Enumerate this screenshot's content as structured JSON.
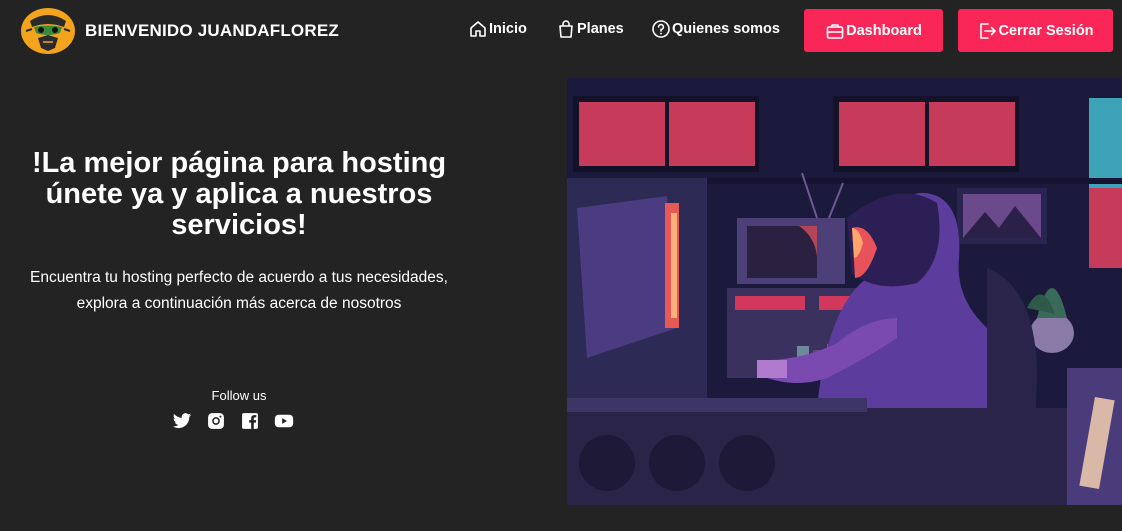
{
  "header": {
    "brand_title": "BIENVENIDO JUANDAFLOREZ",
    "nav": {
      "inicio": "Inicio",
      "planes": "Planes",
      "quienes": "Quienes somos"
    },
    "buttons": {
      "dashboard": "Dashboard",
      "logout": "Cerrar Sesión"
    }
  },
  "hero": {
    "title": "!La mejor página para hosting únete ya y aplica a nuestros servicios!",
    "subtitle_line1": "Encuentra tu hosting perfecto de acuerdo a tus necesidades,",
    "subtitle_line2": "explora a continuación más acerca de nosotros",
    "follow_label": "Follow us",
    "socials": [
      "twitter-icon",
      "instagram-icon",
      "facebook-icon",
      "youtube-icon"
    ]
  },
  "colors": {
    "background": "#232323",
    "accent": "#fb2658",
    "logo_bg": "#f4a41c"
  }
}
